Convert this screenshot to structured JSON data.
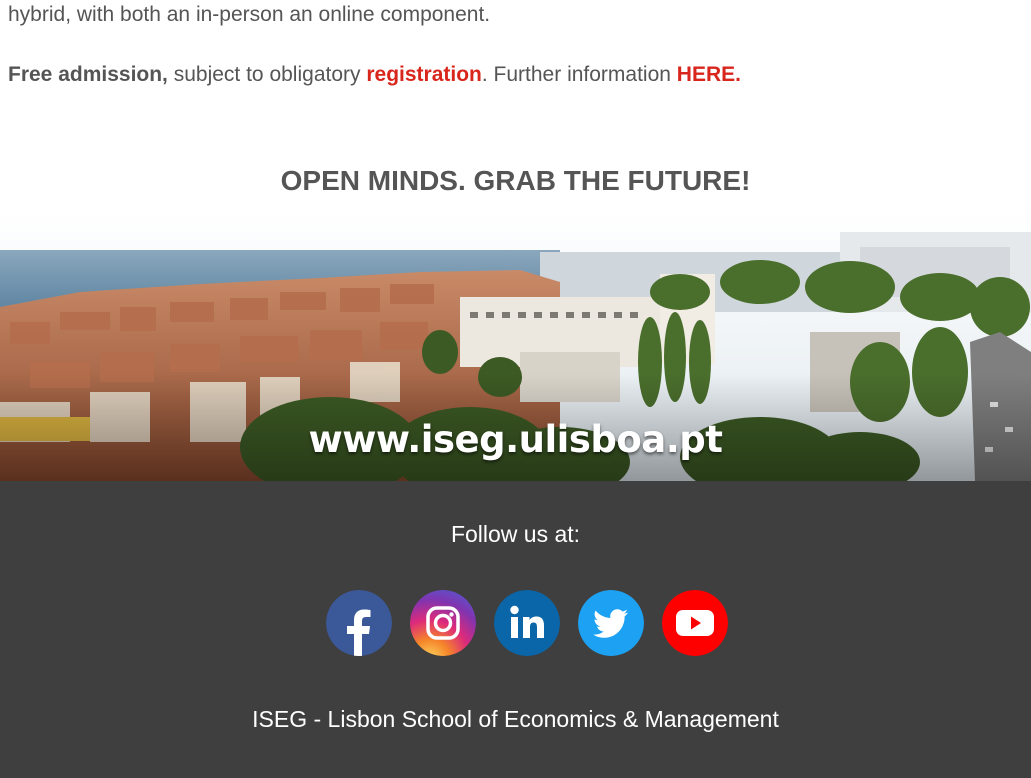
{
  "intro": {
    "line1": "hybrid, with both an in-person an online component.",
    "admission_bold": "Free admission,",
    "admission_mid": " subject to obligatory ",
    "registration_link": "registration",
    "further_text": ". Further information ",
    "here_link": "HERE."
  },
  "slogan": "OPEN MINDS. GRAB THE FUTURE!",
  "banner": {
    "url_text": "www.iseg.ulisboa.pt"
  },
  "footer": {
    "follow_label": "Follow us at:",
    "socials": [
      {
        "name": "facebook",
        "icon": "facebook-icon",
        "color": "#3b5998"
      },
      {
        "name": "instagram",
        "icon": "instagram-icon",
        "color": "#c13584"
      },
      {
        "name": "linkedin",
        "icon": "linkedin-icon",
        "color": "#0077b5"
      },
      {
        "name": "twitter",
        "icon": "twitter-icon",
        "color": "#1da1f2"
      },
      {
        "name": "youtube",
        "icon": "youtube-icon",
        "color": "#ff0000"
      }
    ],
    "organization": "ISEG - Lisbon School of Economics & Management"
  },
  "colors": {
    "link": "#d9261c",
    "text": "#555555",
    "footer_bg": "#3f3f3f"
  }
}
